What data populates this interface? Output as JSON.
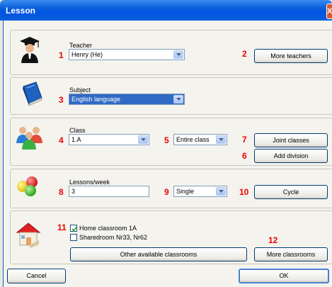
{
  "window": {
    "title": "Lesson",
    "close_label": "X"
  },
  "teacher": {
    "label": "Teacher",
    "value": "Henry (He)",
    "marker_1": "1",
    "marker_2": "2",
    "more_button": "More teachers"
  },
  "subject": {
    "label": "Subject",
    "value": "English language",
    "marker_3": "3"
  },
  "class": {
    "label": "Class",
    "value": "1.A",
    "division_value": "Entire class",
    "marker_4": "4",
    "marker_5": "5",
    "marker_7": "7",
    "marker_6": "6",
    "joint_button": "Joint classes",
    "add_division_button": "Add division"
  },
  "lessons": {
    "label": "Lessons/week",
    "value": "3",
    "length_value": "Single",
    "marker_8": "8",
    "marker_9": "9",
    "marker_10": "10",
    "cycle_button": "Cycle"
  },
  "classrooms": {
    "marker_11": "11",
    "marker_12": "12",
    "home_label": "Home classroom 1A",
    "home_checked": true,
    "shared_label": "Sharedroom Nr33, Nr62",
    "shared_checked": false,
    "other_button": "Other available classrooms",
    "more_button": "More classrooms"
  },
  "footer": {
    "cancel": "Cancel",
    "ok": "OK"
  }
}
